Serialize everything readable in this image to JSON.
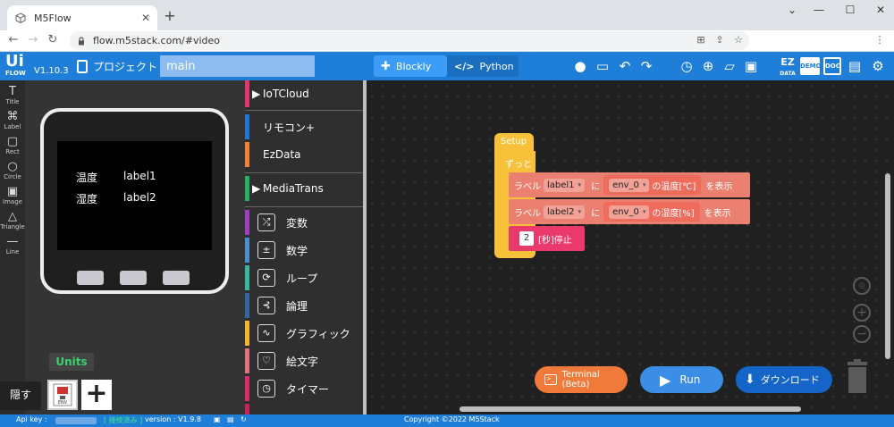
{
  "browser": {
    "tab_title": "M5Flow",
    "url": "flow.m5stack.com/#video"
  },
  "header": {
    "logo_main": "Ui",
    "logo_sub": "FLOW",
    "version": "V1.10.3",
    "project_label": "プロジェクト",
    "project_name": "main",
    "mode_blockly": "Blockly",
    "mode_python": "Python",
    "data_icon_label": "EZ",
    "data_icon_sub": "DATA",
    "demo_label": "DEMO",
    "doc_label": "DOC"
  },
  "tools": [
    {
      "label": "Title",
      "glyph": "T"
    },
    {
      "label": "Label",
      "glyph": "⌘"
    },
    {
      "label": "Rect",
      "glyph": "▢"
    },
    {
      "label": "Circle",
      "glyph": "○"
    },
    {
      "label": "Image",
      "glyph": "▣"
    },
    {
      "label": "Triangle",
      "glyph": "△"
    },
    {
      "label": "Line",
      "glyph": "—"
    }
  ],
  "device": {
    "row1_label": "温度",
    "row1_value": "label1",
    "row2_label": "湿度",
    "row2_value": "label2"
  },
  "units_label": "Units",
  "hide_label": "隠す",
  "unit_item_label": "ENV",
  "categories": [
    {
      "label": "IoTCloud",
      "color": "#e8336d",
      "arrow": "▶",
      "icon": ""
    },
    {
      "label": "リモコン+",
      "color": "#1b78d4",
      "arrow": "",
      "icon": ""
    },
    {
      "label": "EzData",
      "color": "#f2813a",
      "arrow": "",
      "icon": ""
    },
    {
      "label": "MediaTrans",
      "color": "#22b463",
      "arrow": "▶",
      "icon": ""
    },
    {
      "label": "変数",
      "color": "#a33dbf",
      "arrow": "",
      "icon": "⤮"
    },
    {
      "label": "数学",
      "color": "#4a91d1",
      "arrow": "",
      "icon": "±"
    },
    {
      "label": "ループ",
      "color": "#3ab7a3",
      "arrow": "",
      "icon": "⟳"
    },
    {
      "label": "論理",
      "color": "#3465a5",
      "arrow": "",
      "icon": "⊰"
    },
    {
      "label": "グラフィック",
      "color": "#f2b52a",
      "arrow": "",
      "icon": "∿"
    },
    {
      "label": "絵文字",
      "color": "#e8707a",
      "arrow": "",
      "icon": "♡"
    },
    {
      "label": "タイマー",
      "color": "#e0296a",
      "arrow": "",
      "icon": "◷"
    }
  ],
  "blocks": {
    "setup": "Setup",
    "loop": "ずっと",
    "label_word": "ラベル",
    "ni": "に",
    "show": "を表示",
    "row1": {
      "label": "label1",
      "env": "env_0",
      "prop": "の温度[℃]"
    },
    "row2": {
      "label": "label2",
      "env": "env_0",
      "prop": "の湿度[%]"
    },
    "wait_value": "2",
    "wait_text": "[秒]停止"
  },
  "actions": {
    "terminal": "Terminal (Beta)",
    "run": "Run",
    "download": "ダウンロード"
  },
  "footer": {
    "api_key": "Api key :",
    "status": "[ 接続済み ]",
    "version": "version : V1.9.8",
    "copyright": "Copyright ©2022 M5Stack"
  },
  "colors": {
    "brand_blue": "#1f7fd8",
    "setup_yellow": "#f7c13a",
    "label_block": "#ec8070",
    "wait_block": "#e93a6b",
    "terminal_orange": "#f07a3a",
    "run_blue": "#3c8de6",
    "download_blue": "#1565c8"
  }
}
